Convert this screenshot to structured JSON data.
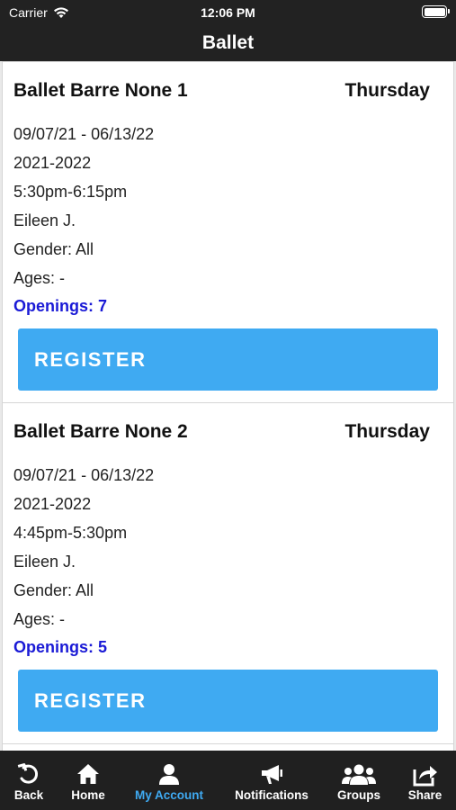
{
  "status_bar": {
    "carrier": "Carrier",
    "time": "12:06 PM"
  },
  "header": {
    "title": "Ballet"
  },
  "classes": [
    {
      "name": "Ballet Barre None 1",
      "day": "Thursday",
      "dates": "09/07/21 - 06/13/22",
      "season": "2021-2022",
      "time": "5:30pm-6:15pm",
      "instructor": "Eileen J.",
      "gender": "Gender: All",
      "ages": "Ages: -",
      "openings": "Openings: 7",
      "register_label": "REGISTER"
    },
    {
      "name": "Ballet Barre None 2",
      "day": "Thursday",
      "dates": "09/07/21 - 06/13/22",
      "season": "2021-2022",
      "time": "4:45pm-5:30pm",
      "instructor": "Eileen J.",
      "gender": "Gender: All",
      "ages": "Ages: -",
      "openings": "Openings: 5",
      "register_label": "REGISTER"
    }
  ],
  "tab_bar": {
    "active": "My Account",
    "tabs": [
      {
        "label": "Back",
        "icon": "back-icon"
      },
      {
        "label": "Home",
        "icon": "home-icon"
      },
      {
        "label": "My Account",
        "icon": "user-icon"
      },
      {
        "label": "Notifications",
        "icon": "megaphone-icon"
      },
      {
        "label": "Groups",
        "icon": "groups-icon"
      },
      {
        "label": "Share",
        "icon": "share-icon"
      }
    ]
  },
  "colors": {
    "accent": "#3faaf2",
    "openings": "#1a1ad6",
    "bar": "#222222"
  }
}
